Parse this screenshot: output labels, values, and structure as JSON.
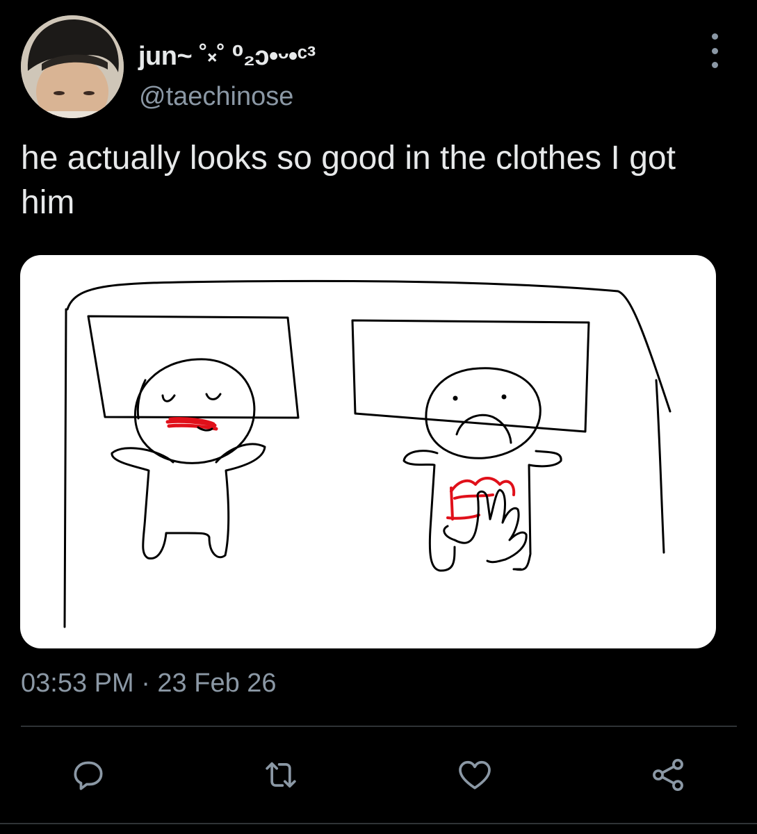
{
  "author": {
    "display_name": "jun~ ˚༝˚ ⁰₂ɔ•ᵕ•ᶜ³",
    "handle": "@taechinose"
  },
  "tweet": {
    "text": "he actually looks so good in the clothes I got him",
    "timestamp": "03:53 PM · 23 Feb 26"
  },
  "icons": {
    "more": "more-vertical-icon",
    "reply": "reply-icon",
    "retweet": "retweet-icon",
    "like": "heart-icon",
    "share": "share-icon"
  },
  "colors": {
    "background": "#000000",
    "text": "#e7e9ea",
    "secondary_text": "#8b98a5",
    "divider": "#2f3336",
    "drawing_red": "#e0101a"
  }
}
